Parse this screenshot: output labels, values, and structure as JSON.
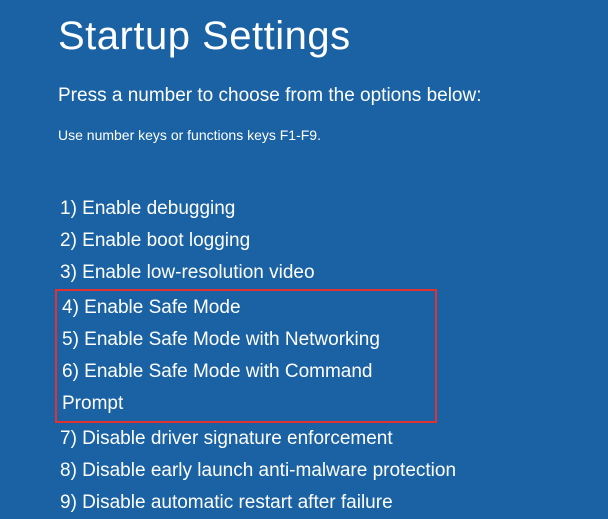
{
  "title": "Startup Settings",
  "subtitle": "Press a number to choose from the options below:",
  "hint": "Use number keys or functions keys F1-F9.",
  "options": {
    "o1": "1) Enable debugging",
    "o2": "2) Enable boot logging",
    "o3": "3) Enable low-resolution video",
    "o4": "4) Enable Safe Mode",
    "o5": "5) Enable Safe Mode with Networking",
    "o6": "6) Enable Safe Mode with Command Prompt",
    "o7": "7) Disable driver signature enforcement",
    "o8": "8) Disable early launch anti-malware protection",
    "o9": "9) Disable automatic restart after failure"
  },
  "highlight": {
    "color": "#e03232"
  }
}
